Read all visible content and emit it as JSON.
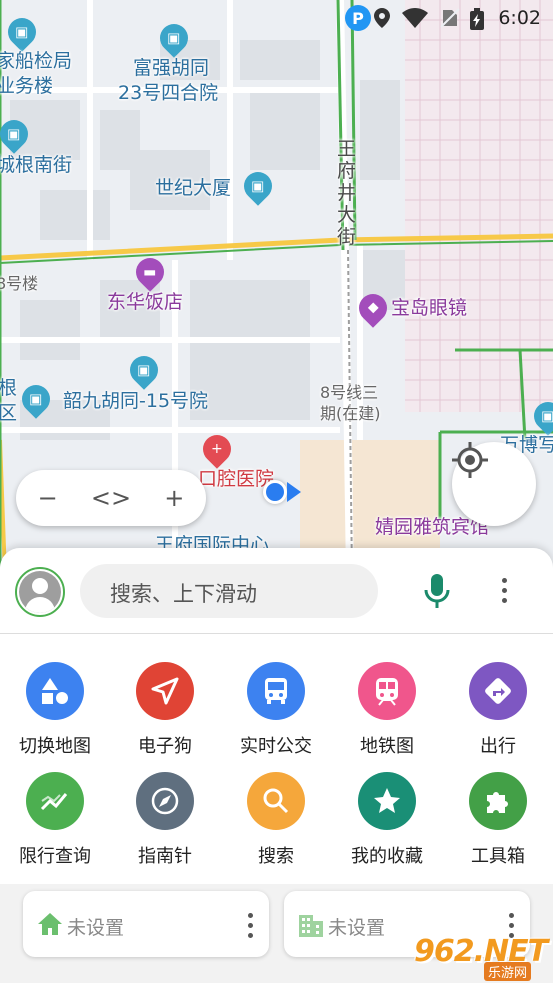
{
  "status_bar": {
    "time": "6:02",
    "icons": [
      "parking-icon",
      "location-icon",
      "wifi-icon",
      "no-sim-icon",
      "battery-charging-icon"
    ],
    "parking_letter": "P"
  },
  "map": {
    "labels": {
      "shipping_bureau_line1": "家船检局",
      "shipping_bureau_line2": "业务楼",
      "fuqiang_line1": "富强胡同",
      "fuqiang_line2": "23号四合院",
      "cheng_gen": "城根南街",
      "century_tower": "世纪大厦",
      "wangfujing_street": "王府井大街",
      "building8": "8号楼",
      "donghua_hotel": "东华饭店",
      "baodao_glasses": "宝岛眼镜",
      "gen_qu_line1": "根",
      "gen_qu_line2": "区",
      "shaojiu_hutong": "韶九胡同-15号院",
      "line8_line1": "8号线三",
      "line8_line2": "期(在建)",
      "dental_hospital": "口腔医院",
      "jingyuan_hotel": "婧园雅筑宾馆",
      "wanbo": "万博写",
      "wangfu_center": "王府国际中心"
    },
    "zoom": {
      "out": "−",
      "toggle": "<>",
      "in": "+"
    },
    "colors": {
      "road": "#4caf50",
      "main_road": "#f7c948",
      "water": "#dfe3e8"
    }
  },
  "sheet": {
    "search_placeholder": "搜索、上下滑动",
    "grid": [
      {
        "label": "切换地图",
        "icon": "shapes-icon",
        "color": "#3d82f0"
      },
      {
        "label": "电子狗",
        "icon": "navigation-arrow-icon",
        "color": "#e04435"
      },
      {
        "label": "实时公交",
        "icon": "bus-icon",
        "color": "#3d82f0"
      },
      {
        "label": "地铁图",
        "icon": "subway-icon",
        "color": "#f0568c"
      },
      {
        "label": "出行",
        "icon": "directions-icon",
        "color": "#7e57c2"
      },
      {
        "label": "限行查询",
        "icon": "trend-icon",
        "color": "#4caf50"
      },
      {
        "label": "指南针",
        "icon": "compass-icon",
        "color": "#5f6f7f"
      },
      {
        "label": "搜索",
        "icon": "search-icon",
        "color": "#f5a73b"
      },
      {
        "label": "我的收藏",
        "icon": "star-icon",
        "color": "#1a8f76"
      },
      {
        "label": "工具箱",
        "icon": "puzzle-icon",
        "color": "#43a047"
      }
    ],
    "shortcuts": [
      {
        "label": "未设置",
        "icon": "home-icon"
      },
      {
        "label": "未设置",
        "icon": "office-icon"
      }
    ]
  },
  "watermark": {
    "logo": "962.NET",
    "sub": "乐游网"
  }
}
